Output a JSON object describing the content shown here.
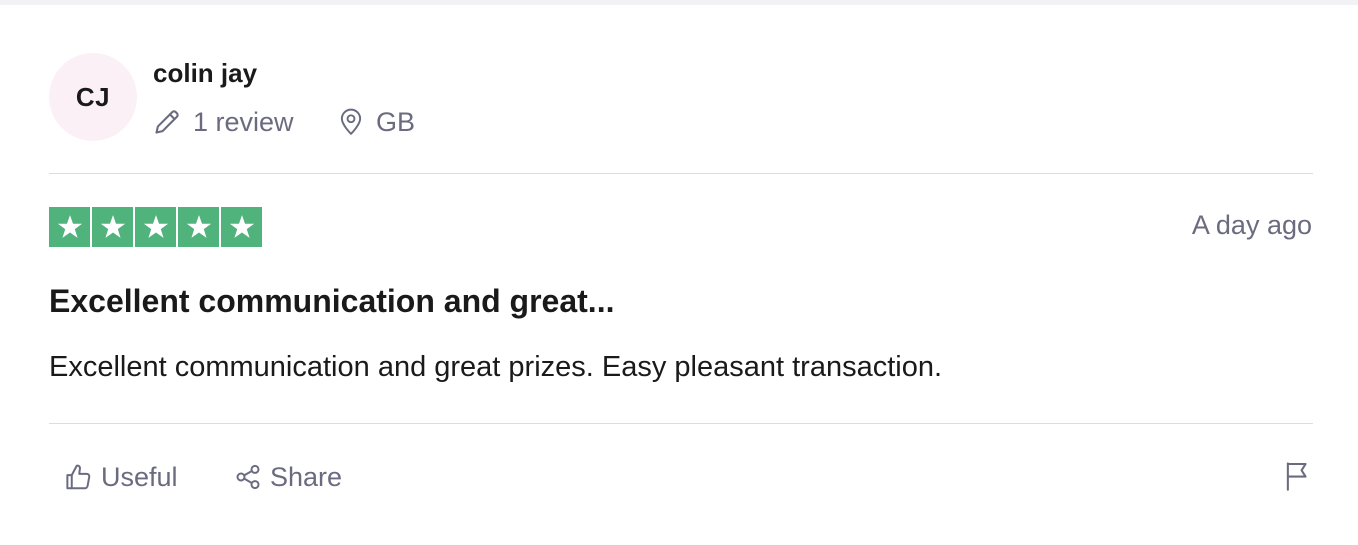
{
  "reviewer": {
    "initials": "CJ",
    "name": "colin jay",
    "review_count": "1 review",
    "country": "GB"
  },
  "review": {
    "rating": 5,
    "rating_max": 5,
    "date": "A day ago",
    "title": "Excellent communication and great...",
    "body": "Excellent communication and great prizes. Easy pleasant transaction."
  },
  "actions": {
    "useful_label": "Useful",
    "share_label": "Share"
  },
  "colors": {
    "star_green": "#4fb37b",
    "avatar_bg": "#fcf0f7",
    "muted_text": "#6b6b80"
  },
  "icons": {
    "pencil": "pencil-icon",
    "location": "location-pin-icon",
    "star": "star-icon",
    "thumbs_up": "thumbs-up-icon",
    "share": "share-icon",
    "flag": "flag-icon"
  }
}
